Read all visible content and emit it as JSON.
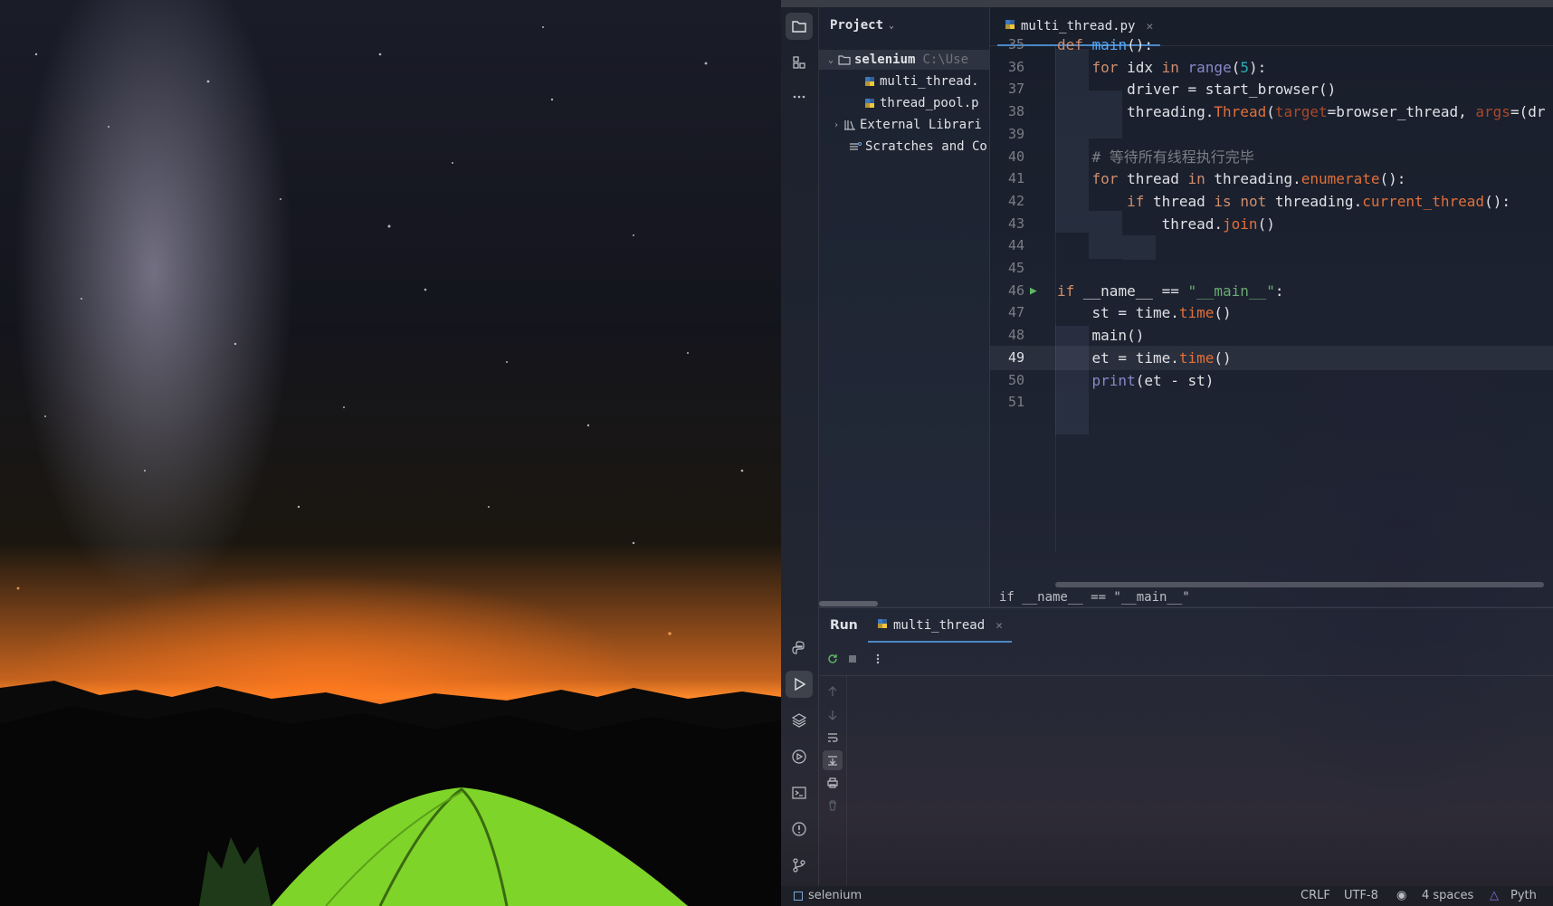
{
  "project_panel": {
    "title": "Project",
    "root": {
      "name": "selenium",
      "path": "C:\\Use"
    },
    "files": [
      "multi_thread.",
      "thread_pool.p"
    ],
    "external": "External Librari",
    "scratches": "Scratches and Co"
  },
  "editor": {
    "tab_label": "multi_thread.py",
    "breadcrumb": "if __name__ == \"__main__\"",
    "lines": [
      {
        "n": "35",
        "t": "def main():"
      },
      {
        "n": "36",
        "t": "    for idx in range(5):"
      },
      {
        "n": "37",
        "t": "        driver = start_browser()"
      },
      {
        "n": "38",
        "t": "        threading.Thread(target=browser_thread, args=(dr"
      },
      {
        "n": "39",
        "t": ""
      },
      {
        "n": "40",
        "t": "    # 等待所有线程执行完毕"
      },
      {
        "n": "41",
        "t": "    for thread in threading.enumerate():"
      },
      {
        "n": "42",
        "t": "        if thread is not threading.current_thread():"
      },
      {
        "n": "43",
        "t": "            thread.join()"
      },
      {
        "n": "44",
        "t": ""
      },
      {
        "n": "45",
        "t": ""
      },
      {
        "n": "46",
        "t": "if __name__ == \"__main__\":"
      },
      {
        "n": "47",
        "t": "    st = time.time()"
      },
      {
        "n": "48",
        "t": "    main()"
      },
      {
        "n": "49",
        "t": "    et = time.time()"
      },
      {
        "n": "50",
        "t": "    print(et - st)"
      },
      {
        "n": "51",
        "t": ""
      }
    ]
  },
  "run_panel": {
    "title": "Run",
    "tab_label": "multi_thread"
  },
  "status_bar": {
    "project": "selenium",
    "line_sep": "CRLF",
    "encoding": "UTF-8",
    "indent": "4 spaces",
    "interpreter": "Pyth"
  },
  "colors": {
    "accent": "#4a88c7",
    "keyword": "#cf8e6d",
    "function": "#56a8f5",
    "string": "#6aab73",
    "number": "#2aacb8"
  },
  "icons": [
    "folder-icon",
    "structure-icon",
    "more-icon",
    "python-console-icon",
    "run-icon",
    "layers-icon",
    "services-icon",
    "terminal-icon",
    "problems-icon",
    "git-icon"
  ]
}
